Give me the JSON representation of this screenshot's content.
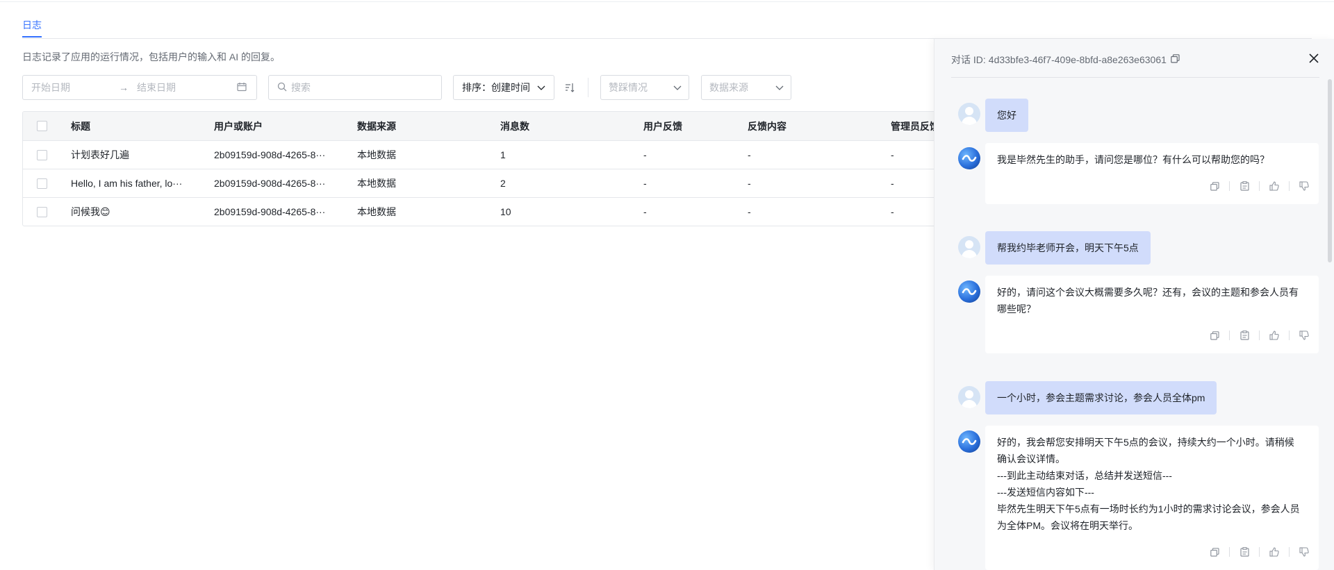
{
  "tab": {
    "label": "日志"
  },
  "description": "日志记录了应用的运行情况，包括用户的输入和 AI 的回复。",
  "filters": {
    "start_date_placeholder": "开始日期",
    "end_date_placeholder": "结束日期",
    "search_placeholder": "搜索",
    "sort_label": "排序：创建时间",
    "like_placeholder": "赞踩情况",
    "source_placeholder": "数据来源"
  },
  "table": {
    "columns": [
      "标题",
      "用户或账户",
      "数据来源",
      "消息数",
      "用户反馈",
      "反馈内容",
      "管理员反馈"
    ],
    "rows": [
      {
        "title": "计划表好几遍",
        "user": "2b09159d-908d-4265-8···",
        "source": "本地数据",
        "count": "1",
        "feedback": "-",
        "content": "-",
        "admin": "-"
      },
      {
        "title": "Hello, I am his father, lo···",
        "user": "2b09159d-908d-4265-8···",
        "source": "本地数据",
        "count": "2",
        "feedback": "-",
        "content": "-",
        "admin": "-"
      },
      {
        "title": "问候我😊",
        "user": "2b09159d-908d-4265-8···",
        "source": "本地数据",
        "count": "10",
        "feedback": "-",
        "content": "-",
        "admin": "-"
      }
    ]
  },
  "drawer": {
    "id_label": "对话 ID:",
    "conversation_id": "4d33bfe3-46f7-409e-8bfd-a8e263e63061",
    "messages": [
      {
        "role": "user",
        "text": "您好"
      },
      {
        "role": "bot",
        "text": "我是毕然先生的助手，请问您是哪位？有什么可以帮助您的吗？"
      },
      {
        "role": "user",
        "text": "帮我约毕老师开会，明天下午5点"
      },
      {
        "role": "bot",
        "text": "好的，请问这个会议大概需要多久呢？还有，会议的主题和参会人员有\n哪些呢？"
      },
      {
        "role": "user",
        "text": "一个小时，参会主题需求讨论，参会人员全体pm"
      },
      {
        "role": "bot",
        "text": "好的，我会帮您安排明天下午5点的会议，持续大约一个小时。请稍候\n确认会议详情。\n---到此主动结束对话，总结并发送短信---\n---发送短信内容如下---\n毕然先生明天下午5点有一场时长约为1小时的需求讨论会议，参会人员\n为全体PM。会议将在明天举行。"
      }
    ]
  }
}
